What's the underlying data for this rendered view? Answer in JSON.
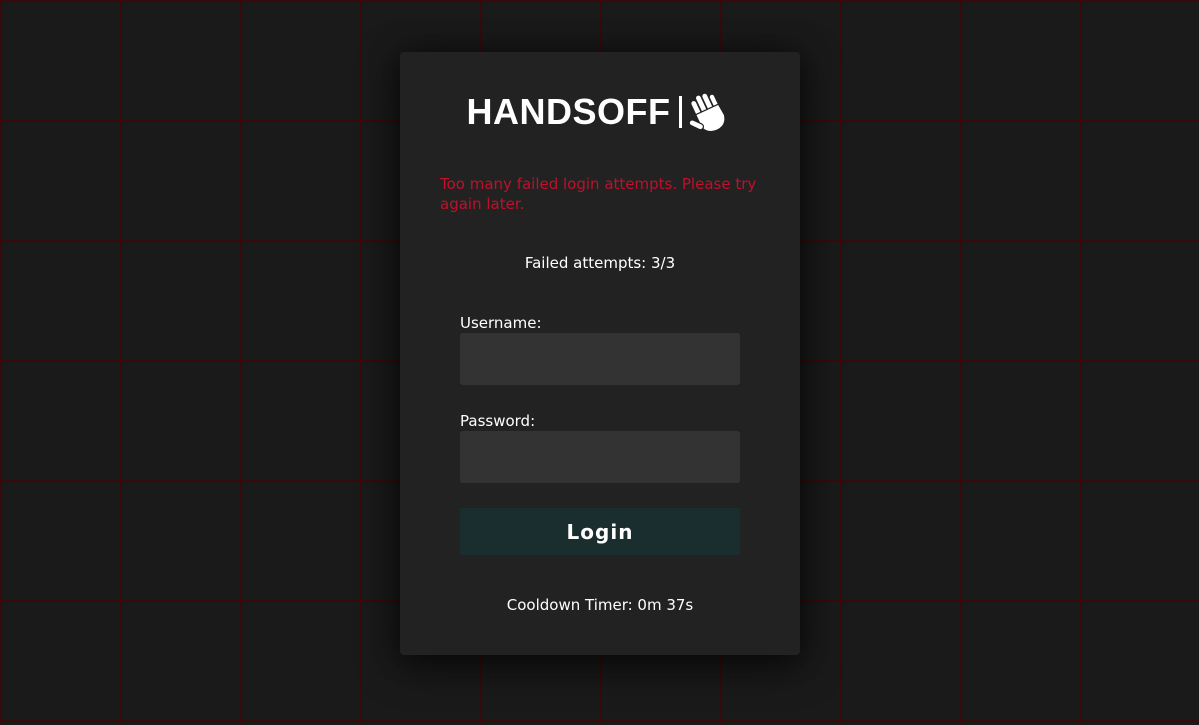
{
  "logo": {
    "text": "HANDSOFF",
    "icon": "waving-hand-icon"
  },
  "error_message": "Too many failed login attempts. Please try again later.",
  "attempts_text": "Failed attempts: 3/3",
  "form": {
    "username_label": "Username:",
    "username_value": "",
    "password_label": "Password:",
    "password_value": "",
    "login_label": "Login"
  },
  "cooldown_text": "Cooldown Timer: 0m 37s",
  "colors": {
    "background": "#1a1a1a",
    "grid_line": "#3a0a0a",
    "card": "#222222",
    "input": "#333333",
    "button": "#1b2e2f",
    "error": "#c0102a"
  }
}
